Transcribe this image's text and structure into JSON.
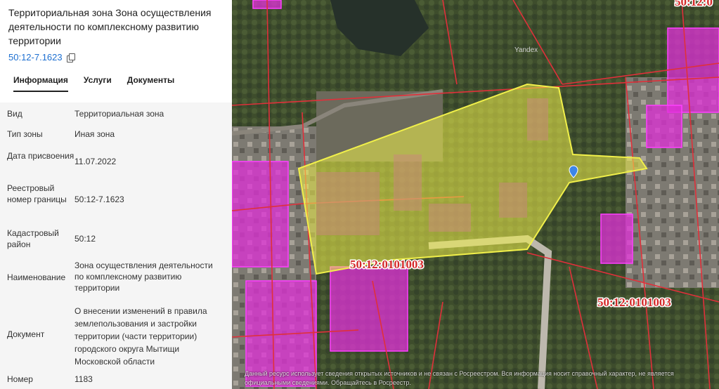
{
  "panel": {
    "title": "Территориальная зона Зона осуществления деятельности по комплексному развитию территории",
    "registry_link": "50:12-7.1623",
    "tabs": [
      "Информация",
      "Услуги",
      "Документы"
    ],
    "rows": [
      {
        "key": "Вид",
        "value": "Территориальная зона"
      },
      {
        "key": "Тип зоны",
        "value": "Иная зона"
      },
      {
        "key": "Дата присвоения",
        "value": "11.07.2022"
      },
      {
        "key": "Реестровый номер границы",
        "value": "50:12-7.1623"
      },
      {
        "key": "Кадастровый район",
        "value": "50:12"
      },
      {
        "key": "Наименование",
        "value": "Зона осуществления деятельности по комплексному развитию территории"
      },
      {
        "key": "Документ",
        "value": "О внесении изменений в правила землепользования и застройки территории (части территории) городского округа Мытищи Московской области"
      },
      {
        "key": "Номер",
        "value": "1183"
      }
    ]
  },
  "map": {
    "labels": [
      "50:12:0101003",
      "50:12:0101003",
      "50:12:0"
    ],
    "watermark": "Yandex",
    "disclaimer": "Данный ресурс использует сведения открытых источников и не связан с Росреестром. Вся информация носит справочный характер, не является официальными сведениями. Обращайтесь в Росреестр."
  },
  "colors": {
    "accent": "#1d6fd1",
    "zone_fill": "#f1f04a",
    "cadastre_line": "#e0303a",
    "magenta": "#e030d8"
  }
}
